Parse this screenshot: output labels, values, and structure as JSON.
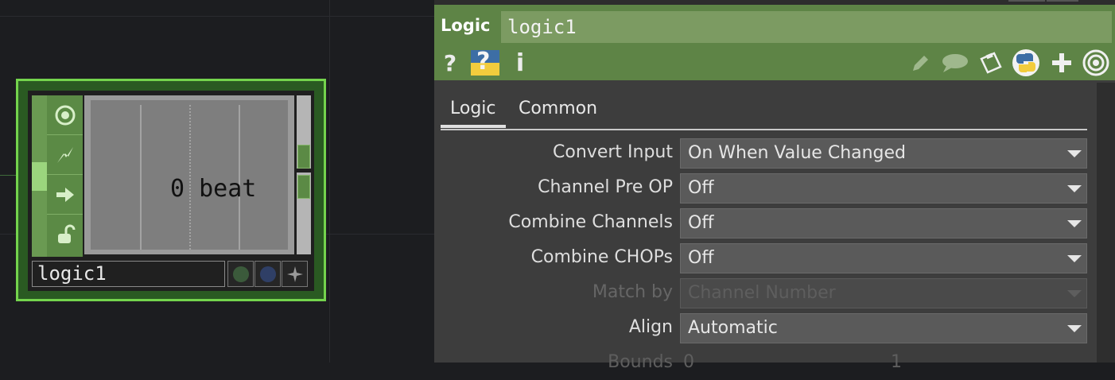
{
  "network": {
    "node": {
      "name": "logic1",
      "viewer_value": "0",
      "viewer_unit": "beat",
      "flags": [
        "viewer-flag-icon",
        "bypass-flag-icon",
        "export-flag-icon",
        "lock-flag-icon"
      ],
      "buttons": [
        "display-dot-icon",
        "render-dot-icon",
        "clone-star-icon"
      ],
      "colors": {
        "border": "#74d44d",
        "body": "#5b8a45"
      }
    }
  },
  "panel": {
    "op_type": "Logic",
    "op_name": "logic1",
    "header_icons": {
      "help": "?",
      "python_help": "?",
      "info": "i",
      "left_group": [
        "help-icon",
        "python-help-icon",
        "info-icon"
      ],
      "right_group": [
        "edit-icon",
        "comment-icon",
        "clipboard-icon",
        "python-icon",
        "plus-icon",
        "target-icon"
      ]
    },
    "tabs": [
      {
        "label": "Logic",
        "active": true
      },
      {
        "label": "Common",
        "active": false
      }
    ],
    "params": [
      {
        "label": "Convert Input",
        "value": "On When Value Changed",
        "enabled": true
      },
      {
        "label": "Channel Pre OP",
        "value": "Off",
        "enabled": true
      },
      {
        "label": "Combine Channels",
        "value": "Off",
        "enabled": true
      },
      {
        "label": "Combine CHOPs",
        "value": "Off",
        "enabled": true
      },
      {
        "label": "Match by",
        "value": "Channel Number",
        "enabled": false
      },
      {
        "label": "Align",
        "value": "Automatic",
        "enabled": true
      }
    ],
    "bounds": {
      "label": "Bounds",
      "min": "0",
      "max": "1"
    },
    "colors": {
      "header": "#5e8446",
      "name_field": "#7c9b62"
    }
  }
}
